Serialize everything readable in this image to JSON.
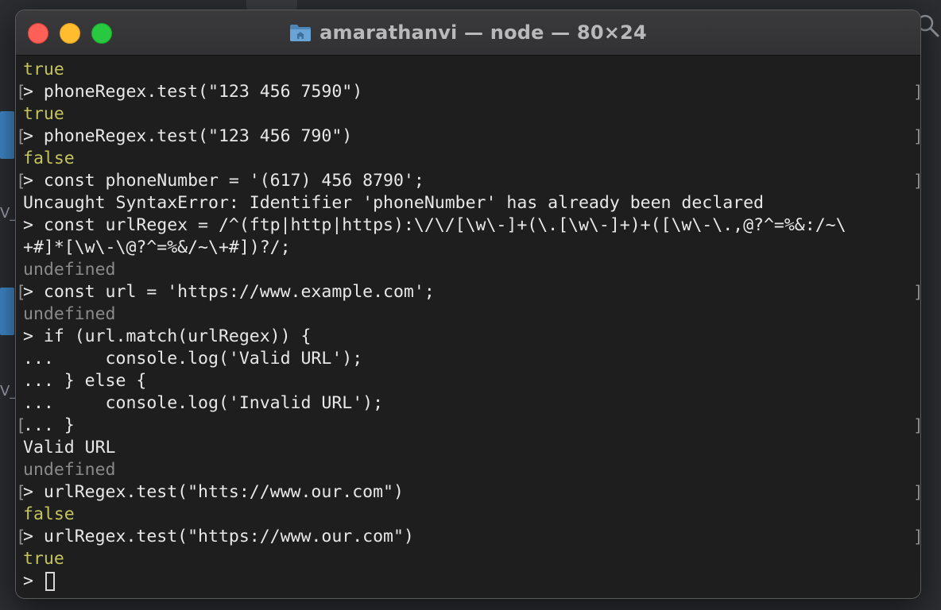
{
  "window": {
    "title": "amarathanvi — node — 80×24"
  },
  "colors": {
    "result": "#c4c45d",
    "undefined": "#8a8a8a",
    "text": "#e8e8e8",
    "close": "#fe5f57",
    "minimize": "#febc2e",
    "maximize": "#28c840"
  },
  "terminal": {
    "lines": [
      {
        "text": "true",
        "color": "yellow",
        "marks": false
      },
      {
        "text": "> phoneRegex.test(\"123 456 7590\")",
        "color": "white",
        "marks": true
      },
      {
        "text": "true",
        "color": "yellow",
        "marks": false
      },
      {
        "text": "> phoneRegex.test(\"123 456 790\")",
        "color": "white",
        "marks": true
      },
      {
        "text": "false",
        "color": "yellow",
        "marks": false
      },
      {
        "text": "> const phoneNumber = '(617) 456 8790';",
        "color": "white",
        "marks": true
      },
      {
        "text": "Uncaught SyntaxError: Identifier 'phoneNumber' has already been declared",
        "color": "white",
        "marks": false
      },
      {
        "text": "> const urlRegex = /^(ftp|http|https):\\/\\/[\\w\\-]+(\\.[\\w\\-]+)+([\\w\\-\\.,@?^=%&:/~\\",
        "color": "white",
        "marks": false
      },
      {
        "text": "+#]*[\\w\\-\\@?^=%&/~\\+#])?/;",
        "color": "white",
        "marks": false
      },
      {
        "text": "undefined",
        "color": "gray",
        "marks": false
      },
      {
        "text": "> const url = 'https://www.example.com';",
        "color": "white",
        "marks": true
      },
      {
        "text": "undefined",
        "color": "gray",
        "marks": false
      },
      {
        "text": "> if (url.match(urlRegex)) {",
        "color": "white",
        "marks": false
      },
      {
        "text": "...     console.log('Valid URL');",
        "color": "white",
        "marks": false
      },
      {
        "text": "... } else {",
        "color": "white",
        "marks": false
      },
      {
        "text": "...     console.log('Invalid URL');",
        "color": "white",
        "marks": false
      },
      {
        "text": "... }",
        "color": "white",
        "marks": true
      },
      {
        "text": "Valid URL",
        "color": "white",
        "marks": false
      },
      {
        "text": "undefined",
        "color": "gray",
        "marks": false
      },
      {
        "text": "> urlRegex.test(\"htts://www.our.com\")",
        "color": "white",
        "marks": true
      },
      {
        "text": "false",
        "color": "yellow",
        "marks": false
      },
      {
        "text": "> urlRegex.test(\"https://www.our.com\")",
        "color": "white",
        "marks": true
      },
      {
        "text": "true",
        "color": "yellow",
        "marks": false
      }
    ],
    "prompt": "> "
  }
}
